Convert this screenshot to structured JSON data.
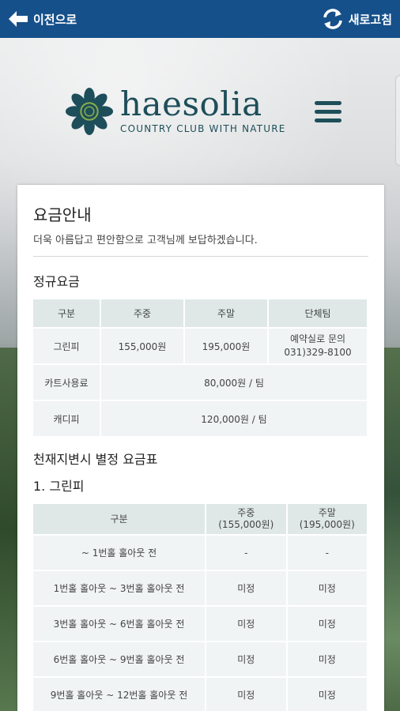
{
  "topbar": {
    "back_label": "이전으로",
    "refresh_label": "새로고침",
    "color": "#16508a"
  },
  "logo": {
    "name": "haesolia",
    "tagline": "COUNTRY CLUB WITH NATURE",
    "color": "#1d4e5a"
  },
  "page": {
    "title": "요금안내",
    "description": "더욱 아름답고 편안함으로 고객님께 보답하겠습니다."
  },
  "regular": {
    "title": "정규요금",
    "headers": [
      "구분",
      "주중",
      "주말",
      "단체팀"
    ],
    "greenfee": {
      "label": "그린피",
      "weekday": "155,000원",
      "weekend": "195,000원",
      "group_line1": "예약실로 문의",
      "group_line2": "031)329-8100"
    },
    "cart": {
      "label": "카트사용료",
      "value": "80,000원 / 팀"
    },
    "caddie": {
      "label": "캐디피",
      "value": "120,000원 / 팀"
    }
  },
  "disaster": {
    "title": "천재지변시 별정 요금표",
    "subtitle": "1. 그린피",
    "headers": {
      "category": "구분",
      "weekday_line1": "주중",
      "weekday_line2": "(155,000원)",
      "weekend_line1": "주말",
      "weekend_line2": "(195,000원)"
    },
    "rows": [
      {
        "label": "~ 1번홀 홀아웃 전",
        "weekday": "-",
        "weekend": "-"
      },
      {
        "label": "1번홀 홀아웃 ~ 3번홀 홀아웃 전",
        "weekday": "미정",
        "weekend": "미정"
      },
      {
        "label": "3번홀 홀아웃 ~ 6번홀 홀아웃 전",
        "weekday": "미정",
        "weekend": "미정"
      },
      {
        "label": "6번홀 홀아웃 ~ 9번홀 홀아웃 전",
        "weekday": "미정",
        "weekend": "미정"
      },
      {
        "label": "9번홀 홀아웃 ~ 12번홀 홀아웃 전",
        "weekday": "미정",
        "weekend": "미정"
      }
    ]
  },
  "icons": [
    "back-arrow-icon",
    "refresh-icon",
    "logo-emblem-icon",
    "hamburger-menu-icon"
  ]
}
